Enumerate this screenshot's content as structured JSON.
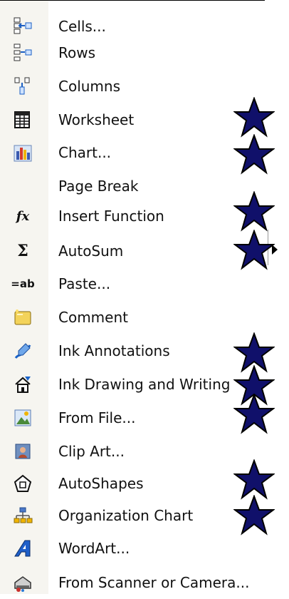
{
  "menu": {
    "items": [
      {
        "label": "Cells...",
        "icon": "insert-cells-icon",
        "starred": false
      },
      {
        "label": "Rows",
        "icon": "insert-rows-icon",
        "starred": false
      },
      {
        "label": "Columns",
        "icon": "insert-columns-icon",
        "starred": false
      },
      {
        "label": "Worksheet",
        "icon": "worksheet-icon",
        "starred": true
      },
      {
        "label": "Chart...",
        "icon": "chart-icon",
        "starred": true
      },
      {
        "label": "Page Break",
        "icon": "",
        "starred": false
      },
      {
        "label": "Insert Function",
        "icon": "function-icon",
        "starred": true
      },
      {
        "label": "AutoSum",
        "icon": "sigma-icon",
        "starred": true,
        "has_submenu": true
      },
      {
        "label": "Paste...",
        "icon": "paste-name-icon",
        "starred": false
      },
      {
        "label": "Comment",
        "icon": "comment-icon",
        "starred": false
      },
      {
        "label": "Ink Annotations",
        "icon": "ink-pen-icon",
        "starred": true
      },
      {
        "label": "Ink Drawing and Writing",
        "icon": "ink-drawing-icon",
        "starred": true
      },
      {
        "label": "From File...",
        "icon": "picture-file-icon",
        "starred": true
      },
      {
        "label": "Clip Art...",
        "icon": "clip-art-icon",
        "starred": false
      },
      {
        "label": "AutoShapes",
        "icon": "autoshapes-icon",
        "starred": true
      },
      {
        "label": "Organization Chart",
        "icon": "org-chart-icon",
        "starred": true
      },
      {
        "label": "WordArt...",
        "icon": "wordart-icon",
        "starred": false
      },
      {
        "label": "From Scanner or Camera...",
        "icon": "scanner-icon",
        "starred": false
      }
    ]
  },
  "colors": {
    "star_fill": "#10106a",
    "star_stroke": "#000000",
    "gutter": "#f6f5f0"
  }
}
